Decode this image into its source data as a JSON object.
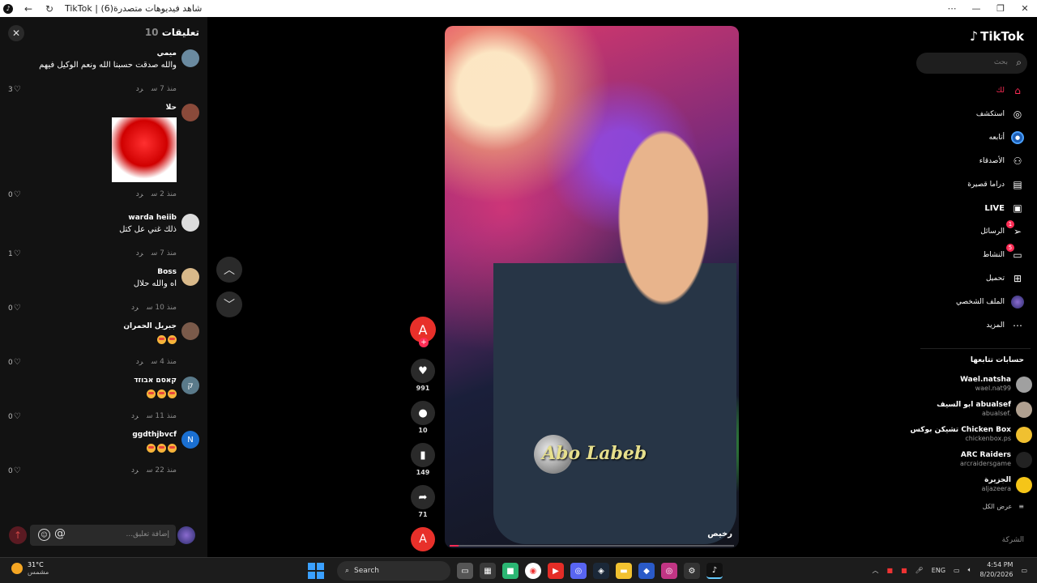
{
  "window": {
    "title": "TikTok | شاهد فيديوهات متصدرة(6)",
    "app_icon": "tiktok-icon"
  },
  "comments": {
    "title": "تعليقات",
    "count": "10",
    "items": [
      {
        "user": "ميمي",
        "text": "والله صدقت حسبنا الله ونعم الوكيل فيهم",
        "time": "منذ 7 س",
        "reply": "رد",
        "likes": "3",
        "avatar_color": "#6a8aa0",
        "has_image": false,
        "emoji_count": 0
      },
      {
        "user": "حلا",
        "text": "",
        "time": "منذ 2 س",
        "reply": "رد",
        "likes": "0",
        "avatar_color": "#8a4a3a",
        "has_image": true,
        "emoji_count": 0
      },
      {
        "user": "warda heiib",
        "text": "ذلك غني عل كتل",
        "time": "منذ 7 س",
        "reply": "رد",
        "likes": "1",
        "avatar_color": "#dddddd",
        "has_image": false,
        "emoji_count": 0
      },
      {
        "user": "Boss",
        "text": "اه والله حلال",
        "time": "منذ 10 س",
        "reply": "رد",
        "likes": "0",
        "avatar_color": "#d9b98a",
        "has_image": false,
        "emoji_count": 0
      },
      {
        "user": "جبريل الحمران",
        "text": "",
        "time": "منذ 4 س",
        "reply": "رد",
        "likes": "0",
        "avatar_color": "#7a5a4a",
        "has_image": false,
        "emoji_count": 2
      },
      {
        "user": "קאסם אבוזד",
        "text": "",
        "time": "منذ 11 س",
        "reply": "رد",
        "likes": "0",
        "avatar_color": "#5a7a8a",
        "avatar_letter": "ק",
        "has_image": false,
        "emoji_count": 3
      },
      {
        "user": "ggdthjbvcf",
        "text": "",
        "time": "منذ 22 س",
        "reply": "رد",
        "likes": "0",
        "avatar_color": "#1a6fd1",
        "avatar_letter": "N",
        "has_image": false,
        "emoji_count": 3
      }
    ],
    "input_placeholder": "إضافة تعليق..."
  },
  "video": {
    "watermark": "Abo Labeb",
    "caption": "رخيص",
    "progress": 0.03
  },
  "actions": {
    "author_initial": "A",
    "likes": "991",
    "comments": "10",
    "saves": "149",
    "shares": "71"
  },
  "sidebar": {
    "logo": "TikTok",
    "search_placeholder": "بحث",
    "nav": [
      {
        "label": "لك",
        "icon": "home-icon",
        "active": true
      },
      {
        "label": "استكشف",
        "icon": "compass-icon"
      },
      {
        "label": "أتابعه",
        "icon": "following-avatar-icon"
      },
      {
        "label": "الأصدقاء",
        "icon": "friends-icon"
      },
      {
        "label": "دراما قصيرة",
        "icon": "film-icon"
      },
      {
        "label": "LIVE",
        "icon": "live-tv-icon"
      },
      {
        "label": "الرسائل",
        "icon": "send-icon",
        "badge": "1"
      },
      {
        "label": "النشاط",
        "icon": "activity-icon",
        "badge": "5"
      },
      {
        "label": "تحميل",
        "icon": "upload-icon"
      },
      {
        "label": "الملف الشخصي",
        "icon": "profile-avatar-icon"
      },
      {
        "label": "المزيد",
        "icon": "more-icon"
      }
    ],
    "following_title": "حسابات تتابعها",
    "following": [
      {
        "name": "Wael.natsha",
        "handle": "wael.nat99",
        "color": "#a0a0a0"
      },
      {
        "name": "ابو السيف abualsef",
        "handle": "abualsef.",
        "color": "#b0a090"
      },
      {
        "name": "تشيكن بوكس Chicken Box",
        "handle": "chickenbox.ps",
        "color": "#f0c030"
      },
      {
        "name": "ARC Raiders",
        "handle": "arcraidersgame",
        "color": "#222222"
      },
      {
        "name": "الجزيرة",
        "handle": "aljazeera",
        "color": "#f5c518"
      }
    ],
    "see_all": "عرض الكل",
    "company": "الشركة"
  },
  "taskbar": {
    "temp": "31°C",
    "weather": "مشمس",
    "search": "Search",
    "lang": "ENG",
    "time": "4:54 PM",
    "date": "8/20/2026"
  }
}
